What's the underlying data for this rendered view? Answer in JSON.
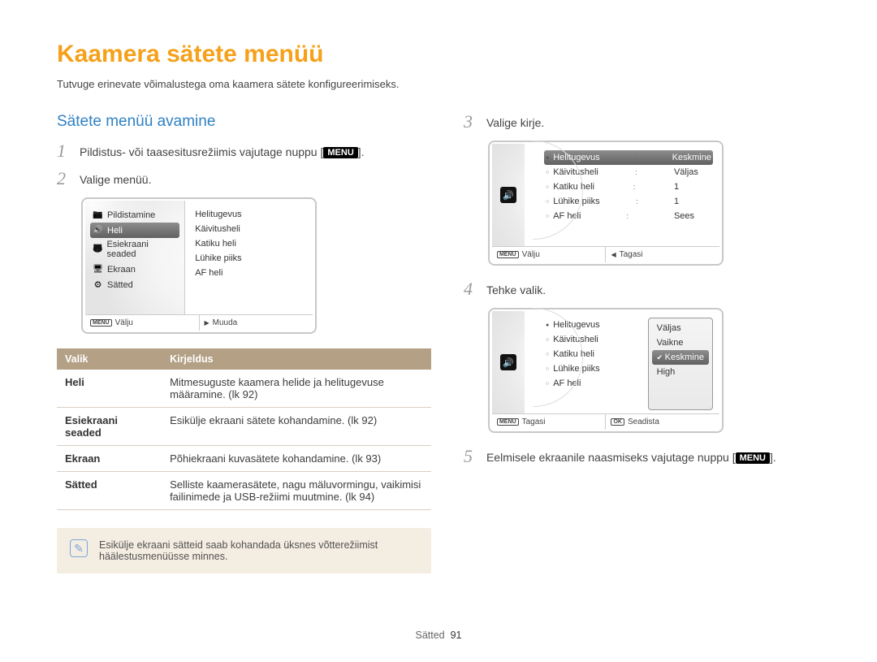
{
  "page": {
    "title": "Kaamera sätete menüü",
    "intro": "Tutvuge erinevate võimalustega oma kaamera sätete konfigureerimiseks.",
    "section_heading": "Sätete menüü avamine",
    "footer_label": "Sätted",
    "footer_page": "91"
  },
  "steps": {
    "s1_pre": "Pildistus- või taasesitusrežiimis vajutage nuppu [",
    "s1_post": "].",
    "menu_badge": "MENU",
    "s2": "Valige menüü.",
    "s3": "Valige kirje.",
    "s4": "Tehke valik.",
    "s5_pre": "Eelmisele ekraanile naasmiseks vajutage nuppu [",
    "s5_post": "]."
  },
  "lcd1": {
    "left": [
      {
        "icon": "cam",
        "label": "Pildistamine"
      },
      {
        "icon": "sound",
        "label": "Heli",
        "selected": true
      },
      {
        "icon": "child",
        "label": "Esiekraani seaded"
      },
      {
        "icon": "screen",
        "label": "Ekraan"
      },
      {
        "icon": "gear",
        "label": "Sätted"
      }
    ],
    "right": [
      "Helitugevus",
      "Käivitusheli",
      "Katiku heli",
      "Lühike piiks",
      "AF heli"
    ],
    "foot_left_badge": "MENU",
    "foot_left": "Välju",
    "foot_right_tri": "▶",
    "foot_right": "Muuda"
  },
  "lcd2": {
    "rows": [
      {
        "label": "Helitugevus",
        "value": "Keskmine",
        "selected": true
      },
      {
        "label": "Käivitusheli",
        "value": "Väljas"
      },
      {
        "label": "Katiku heli",
        "value": "1"
      },
      {
        "label": "Lühike piiks",
        "value": "1"
      },
      {
        "label": "AF heli",
        "value": "Sees"
      }
    ],
    "foot_left_badge": "MENU",
    "foot_left": "Välju",
    "foot_right_tri": "◀",
    "foot_right": "Tagasi"
  },
  "lcd3": {
    "rows": [
      "Helitugevus",
      "Käivitusheli",
      "Katiku heli",
      "Lühike piiks",
      "AF heli"
    ],
    "popup": [
      {
        "label": "Väljas"
      },
      {
        "label": "Vaikne"
      },
      {
        "label": "Keskmine",
        "selected": true
      },
      {
        "label": "High"
      }
    ],
    "foot_left_badge": "MENU",
    "foot_left": "Tagasi",
    "foot_right_badge": "OK",
    "foot_right": "Seadista"
  },
  "table": {
    "head_option": "Valik",
    "head_desc": "Kirjeldus",
    "rows": [
      {
        "k": "Heli",
        "d": "Mitmesuguste kaamera helide ja helitugevuse määramine. (lk 92)"
      },
      {
        "k": "Esiekraani seaded",
        "d": "Esikülje ekraani sätete kohandamine. (lk 92)"
      },
      {
        "k": "Ekraan",
        "d": "Põhiekraani kuvasätete kohandamine. (lk 93)"
      },
      {
        "k": "Sätted",
        "d": "Selliste kaamerasätete, nagu mäluvormingu, vaikimisi failinimede ja USB-režiimi muutmine. (lk 94)"
      }
    ]
  },
  "note": "Esikülje ekraani sätteid saab kohandada üksnes võtterežiimist häälestusmenüüsse minnes."
}
